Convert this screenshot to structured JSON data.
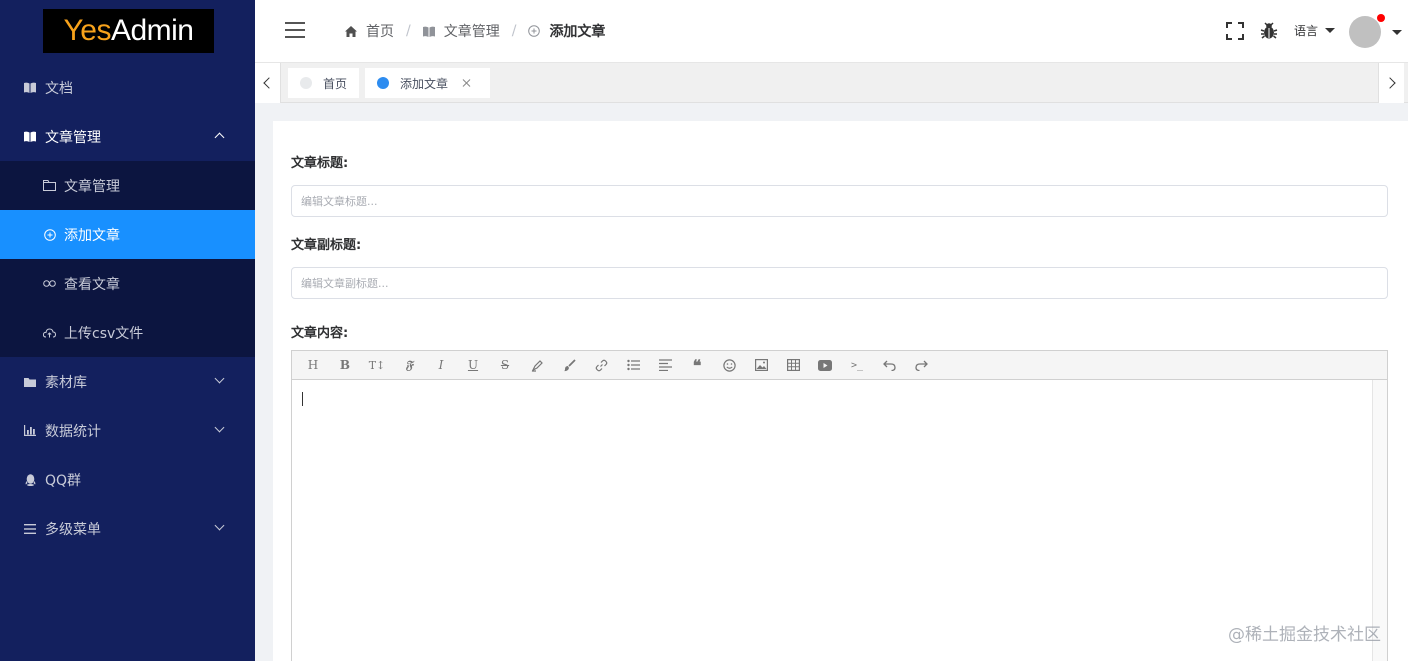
{
  "brand": {
    "part1": "Yes",
    "part2": "Admin"
  },
  "sidebar": {
    "items": [
      {
        "label": "文档"
      },
      {
        "label": "文章管理"
      },
      {
        "label": "素材库"
      },
      {
        "label": "数据统计"
      },
      {
        "label": "QQ群"
      },
      {
        "label": "多级菜单"
      }
    ],
    "submenu": [
      {
        "label": "文章管理"
      },
      {
        "label": "添加文章"
      },
      {
        "label": "查看文章"
      },
      {
        "label": "上传csv文件"
      }
    ]
  },
  "breadcrumb": [
    {
      "label": "首页"
    },
    {
      "label": "文章管理"
    },
    {
      "label": "添加文章"
    }
  ],
  "breadcrumb_sep": "/",
  "header": {
    "lang_label": "语言"
  },
  "tabs": [
    {
      "label": "首页"
    },
    {
      "label": "添加文章"
    }
  ],
  "form": {
    "title_label": "文章标题:",
    "title_placeholder": "编辑文章标题...",
    "subtitle_label": "文章副标题:",
    "subtitle_placeholder": "编辑文章副标题...",
    "content_label": "文章内容:"
  },
  "editor_toolbar": {
    "heading": "H",
    "bold": "B",
    "font_size": "T↕",
    "fraktur": "𝔉",
    "italic": "I",
    "underline": "U",
    "strike": "S"
  },
  "watermark": "@稀土掘金技术社区",
  "colors": {
    "sidebar_bg": "#13205e",
    "submenu_bg": "#0c1540",
    "accent": "#1890ff",
    "brand_yellow": "#f7a21b",
    "tab_active_dot": "#2d8cf0",
    "notification_dot": "#ff0000"
  }
}
